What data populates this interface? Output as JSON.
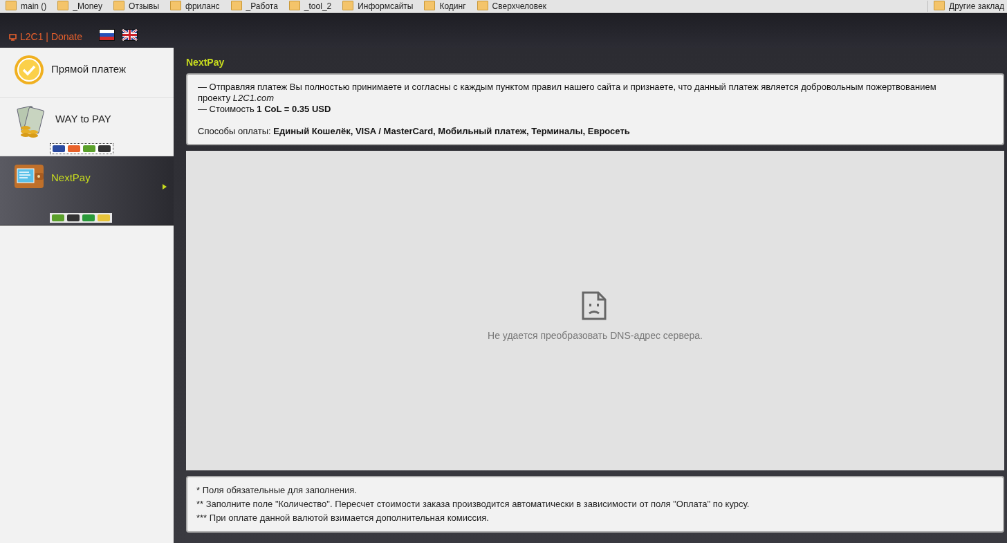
{
  "bookmarks": [
    "main ()",
    "_Money",
    "Отзывы",
    "фриланс",
    "_Работа",
    "_tool_2",
    "Информсайты",
    "Кодинг",
    "Сверхчеловек"
  ],
  "other_bookmarks": "Другие заклад",
  "header": {
    "site_link": "L2C1 | Donate",
    "languages": [
      {
        "kind": "ru"
      },
      {
        "kind": "en"
      }
    ]
  },
  "sidebar": {
    "items": [
      {
        "label": "Прямой платеж",
        "selected": false
      },
      {
        "label": "WAY to PAY",
        "selected": false
      },
      {
        "label": "NextPay",
        "selected": true
      }
    ]
  },
  "main": {
    "title": "NextPay",
    "info": [
      "— Отправляя платеж Вы полностью принимаете и согласны с каждым пунктом правил нашего сайта и признаете, что данный платеж является добровольным пожертвованием проекту *L2C1.com*",
      "— Стоимость **1 CoL = 0.35 USD**"
    ],
    "payment_methods": "Способы оплаты: **Единый Кошелёк, VISA / MasterCard, Мобильный платеж, Терминалы, Евросеть**",
    "frame_error": "Не удается преобразовать DNS-адрес сервера.",
    "notes": [
      "* Поля обязательные для заполнения.",
      "** Заполните поле \"Количество\". Пересчет стоимости заказа производится автоматически в зависимости от поля \"Оплата\" по курсу.",
      "*** При оплате данной валютой взимается дополнительная комиссия."
    ]
  }
}
